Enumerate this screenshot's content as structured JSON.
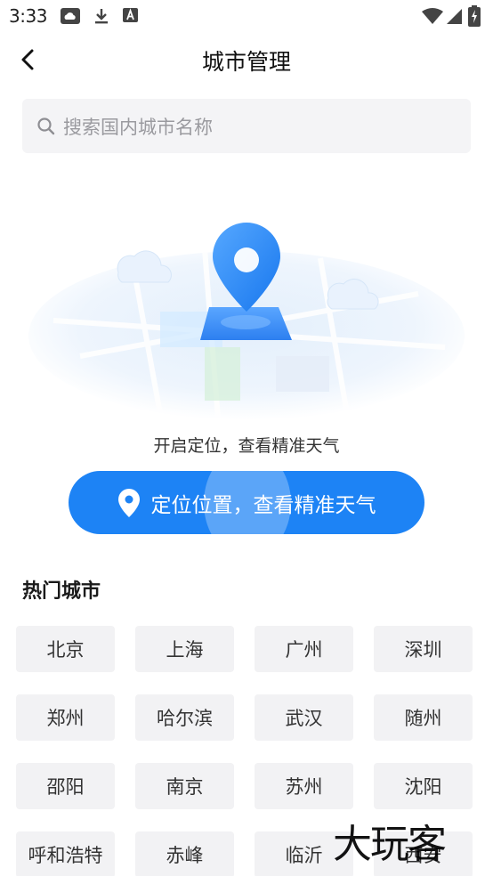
{
  "status_bar": {
    "time": "3:33",
    "left_icons": [
      "cloud-icon",
      "download-icon",
      "font-a-icon"
    ],
    "right_icons": [
      "wifi-icon",
      "signal-icon",
      "battery-charging-icon"
    ]
  },
  "header": {
    "back_icon": "chevron-left-icon",
    "title": "城市管理"
  },
  "search": {
    "icon": "search-icon",
    "placeholder": "搜索国内城市名称"
  },
  "locate": {
    "tip": "开启定位，查看精准天气",
    "button_icon": "location-pin-icon",
    "button_label": "定位位置，查看精准天气",
    "accent_color": "#1d83f5"
  },
  "hot_cities": {
    "title": "热门城市",
    "cities": [
      "北京",
      "上海",
      "广州",
      "深圳",
      "郑州",
      "哈尔滨",
      "武汉",
      "随州",
      "邵阳",
      "南京",
      "苏州",
      "沈阳",
      "呼和浩特",
      "赤峰",
      "临沂",
      "西安"
    ]
  },
  "watermark": {
    "text": "大玩客"
  }
}
